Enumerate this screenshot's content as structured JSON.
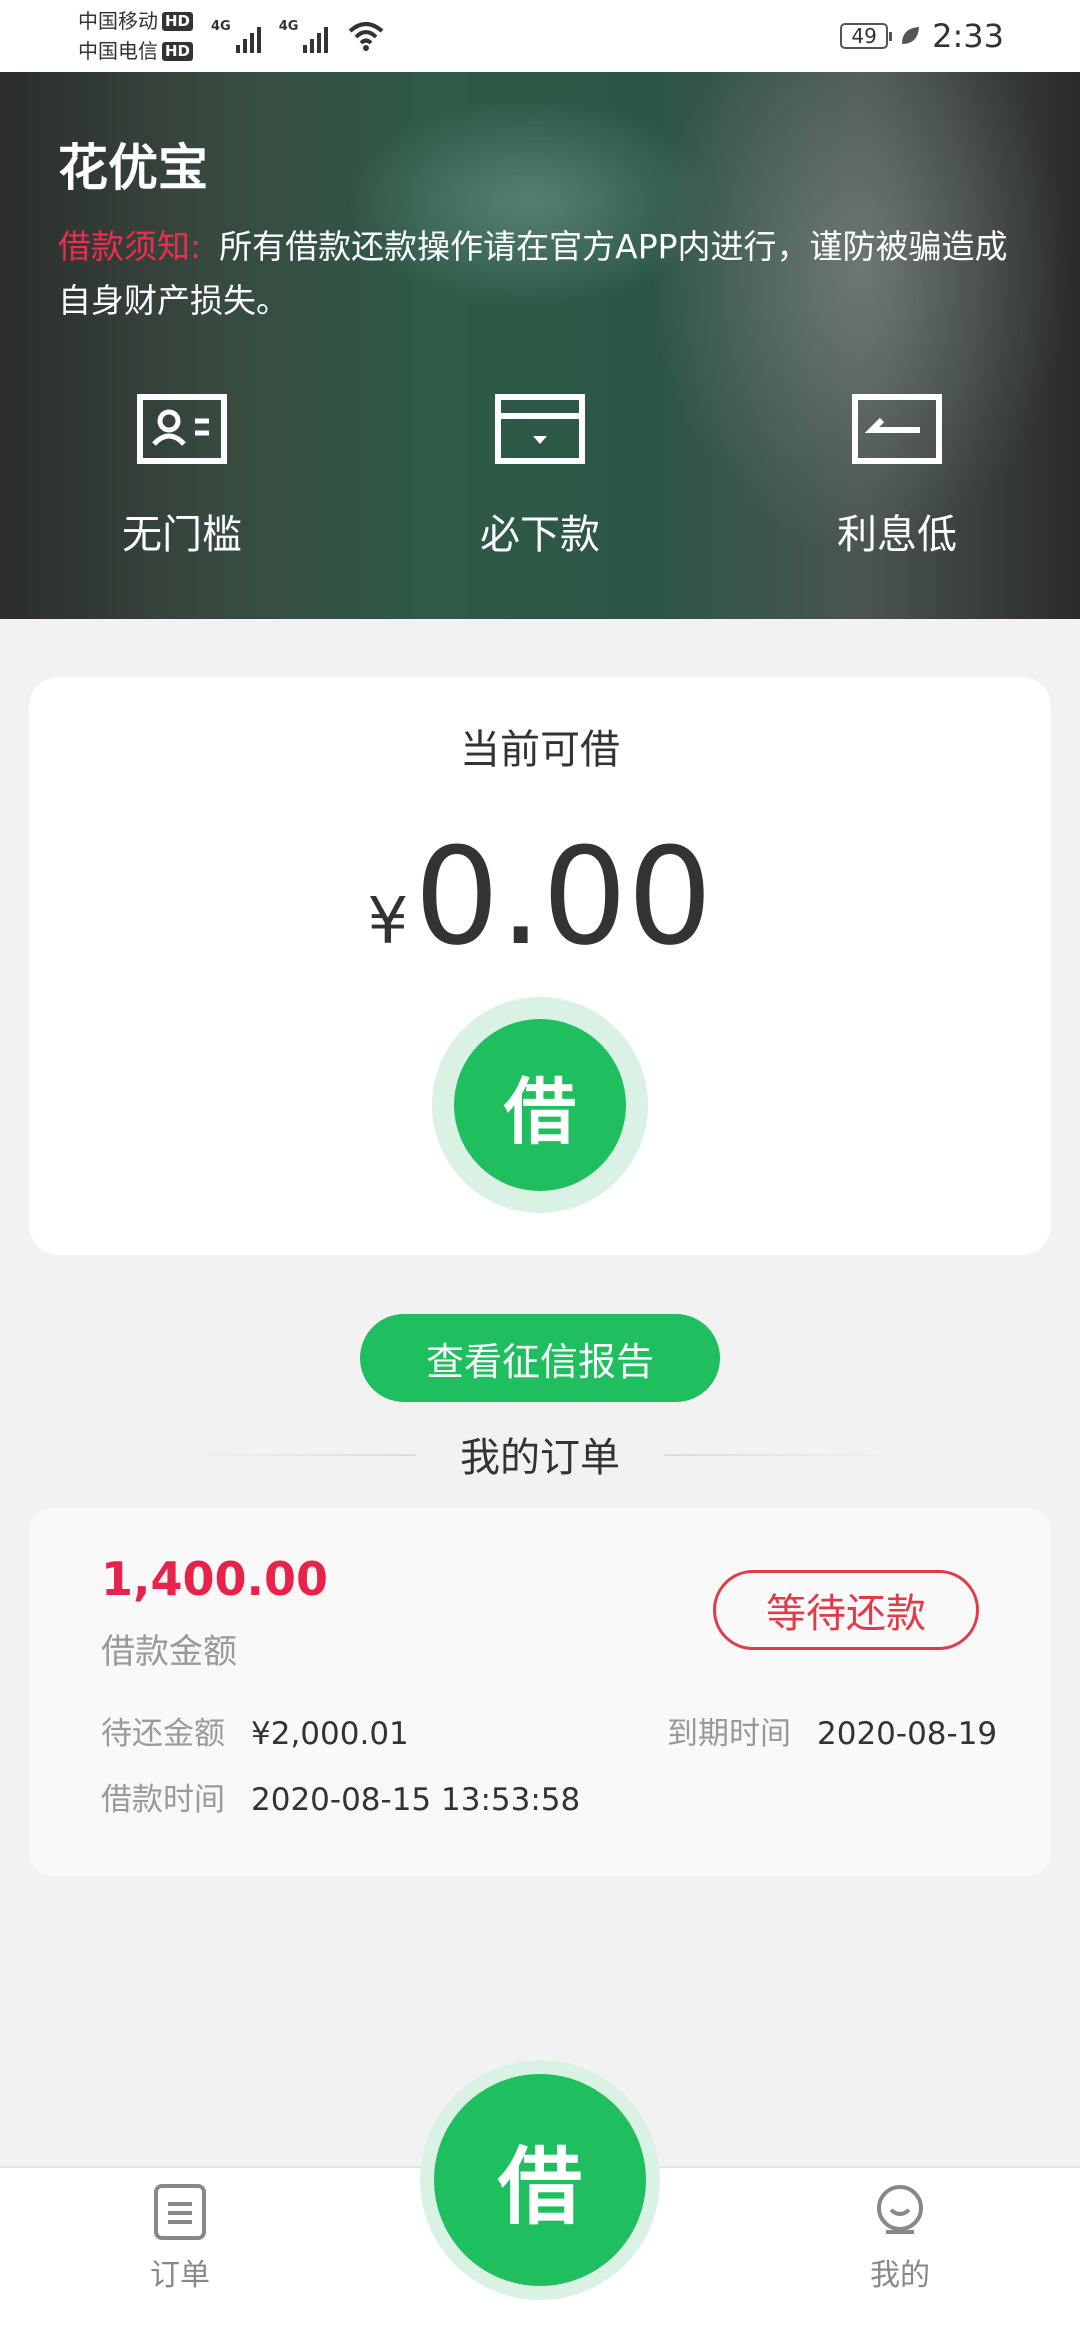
{
  "status_bar": {
    "carrier_1": "中国移动",
    "carrier_2": "中国电信",
    "hd": "HD",
    "network_1": "4G",
    "network_2": "4G",
    "battery": "49",
    "time": "2:33"
  },
  "hero": {
    "title": "花优宝",
    "notice_label": "借款须知:",
    "notice_text": "所有借款还款操作请在官方APP内进行，谨防被骗造成自身财产损失。",
    "features": [
      {
        "label": "无门槛",
        "icon": "id-card-icon"
      },
      {
        "label": "必下款",
        "icon": "wallet-icon"
      },
      {
        "label": "利息低",
        "icon": "return-icon"
      }
    ]
  },
  "loan": {
    "caption": "当前可借",
    "currency": "¥",
    "amount": "0.00",
    "borrow_label": "借"
  },
  "credit_button": "查看征信报告",
  "orders": {
    "title": "我的订单",
    "items": [
      {
        "amount": "1,400.00",
        "amount_label": "借款金额",
        "status": "等待还款",
        "pending_label": "待还金额",
        "pending_value": "¥2,000.01",
        "due_label": "到期时间",
        "due_value": "2020-08-19",
        "loan_time_label": "借款时间",
        "loan_time_value": "2020-08-15 13:53:58"
      }
    ]
  },
  "bottom_nav": {
    "orders_label": "订单",
    "borrow_label": "借",
    "mine_label": "我的"
  },
  "colors": {
    "accent_green": "#1fbe5f",
    "alert_red": "#e8234b",
    "status_red": "#e23a49"
  }
}
